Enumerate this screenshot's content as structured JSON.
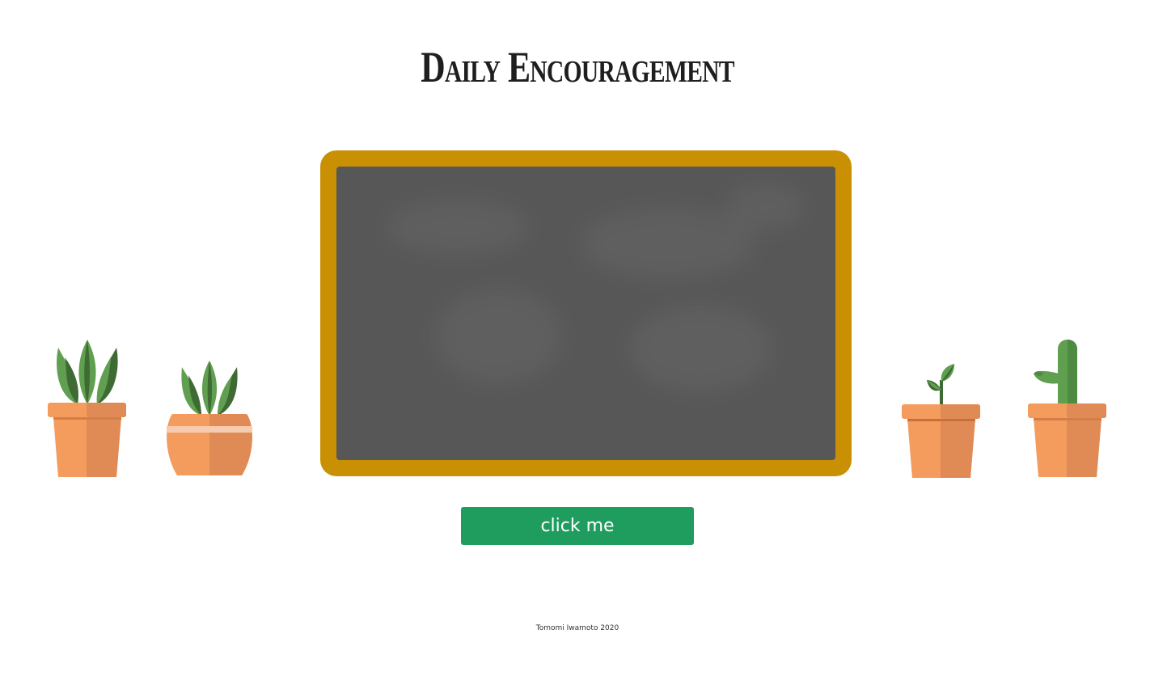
{
  "page": {
    "title": "Daily Encouragement",
    "button_label": "click me",
    "footer_text": "Tomomi Iwamoto 2020"
  },
  "chalkboard": {
    "message": "",
    "frame_color": "#c99003",
    "surface_color": "#575757"
  },
  "plants": [
    {
      "name": "snake-plant-pot-icon"
    },
    {
      "name": "succulent-round-pot-icon"
    },
    {
      "name": "sprout-pot-icon"
    },
    {
      "name": "cactus-pot-icon"
    }
  ],
  "colors": {
    "button": "#1f9d5f",
    "pot_light": "#f49b5e",
    "pot_dark": "#e08b55",
    "leaf_light": "#5f9f4f",
    "leaf_dark": "#3e6a33"
  }
}
